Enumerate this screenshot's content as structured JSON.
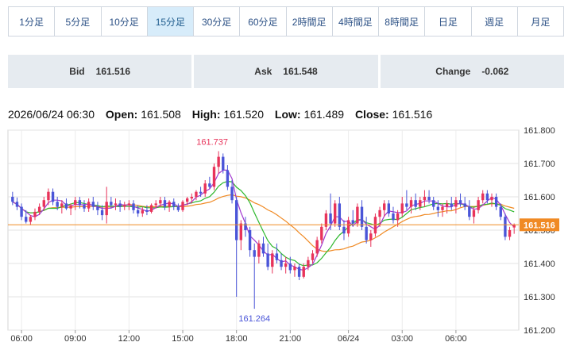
{
  "tabs": [
    {
      "label": "1分足",
      "active": false
    },
    {
      "label": "5分足",
      "active": false
    },
    {
      "label": "10分足",
      "active": false
    },
    {
      "label": "15分足",
      "active": true
    },
    {
      "label": "30分足",
      "active": false
    },
    {
      "label": "60分足",
      "active": false
    },
    {
      "label": "2時間足",
      "active": false
    },
    {
      "label": "4時間足",
      "active": false
    },
    {
      "label": "8時間足",
      "active": false
    },
    {
      "label": "日足",
      "active": false
    },
    {
      "label": "週足",
      "active": false
    },
    {
      "label": "月足",
      "active": false
    }
  ],
  "quotes": {
    "bid_label": "Bid",
    "bid": "161.516",
    "ask_label": "Ask",
    "ask": "161.548",
    "change_label": "Change",
    "change": "-0.062"
  },
  "ohlc": {
    "datetime": "2026/06/24 06:30",
    "open_label": "Open:",
    "open": "161.508",
    "high_label": "High:",
    "high": "161.520",
    "low_label": "Low:",
    "low": "161.489",
    "close_label": "Close:",
    "close": "161.516"
  },
  "colors": {
    "up": "#e8335a",
    "down": "#4a55d8",
    "ma_green": "#2db82d",
    "ma_orange": "#f08a24",
    "ma_purple": "#a23ad0",
    "current_line": "#f08a24",
    "current_badge": "#f08a24"
  },
  "chart_data": {
    "type": "candlestick",
    "ylim": [
      161.2,
      161.8
    ],
    "y_ticks": [
      "161.800",
      "161.700",
      "161.600",
      "161.500",
      "161.400",
      "161.300",
      "161.200"
    ],
    "x_tick_labels": [
      "06:00",
      "09:00",
      "12:00",
      "15:00",
      "18:00",
      "21:00",
      "06/24",
      "03:00",
      "06:00"
    ],
    "grid": true,
    "current_price": "161.516",
    "annotations": [
      {
        "text": "161.737",
        "type": "high"
      },
      {
        "text": "161.264",
        "type": "low"
      }
    ],
    "ohlc": [
      [
        161.6,
        161.615,
        161.575,
        161.585
      ],
      [
        161.585,
        161.598,
        161.56,
        161.57
      ],
      [
        161.57,
        161.58,
        161.53,
        161.54
      ],
      [
        161.54,
        161.56,
        161.52,
        161.525
      ],
      [
        161.525,
        161.545,
        161.515,
        161.54
      ],
      [
        161.54,
        161.565,
        161.53,
        161.555
      ],
      [
        161.555,
        161.58,
        161.545,
        161.57
      ],
      [
        161.57,
        161.6,
        161.56,
        161.59
      ],
      [
        161.59,
        161.625,
        161.575,
        161.615
      ],
      [
        161.615,
        161.625,
        161.575,
        161.585
      ],
      [
        161.585,
        161.6,
        161.56,
        161.57
      ],
      [
        161.57,
        161.59,
        161.55,
        161.58
      ],
      [
        161.58,
        161.595,
        161.56,
        161.565
      ],
      [
        161.565,
        161.58,
        161.545,
        161.575
      ],
      [
        161.575,
        161.6,
        161.56,
        161.59
      ],
      [
        161.59,
        161.6,
        161.565,
        161.575
      ],
      [
        161.575,
        161.59,
        161.555,
        161.565
      ],
      [
        161.565,
        161.595,
        161.555,
        161.585
      ],
      [
        161.585,
        161.6,
        161.56,
        161.57
      ],
      [
        161.57,
        161.585,
        161.545,
        161.56
      ],
      [
        161.56,
        161.575,
        161.53,
        161.545
      ],
      [
        161.545,
        161.63,
        161.52,
        161.585
      ],
      [
        161.585,
        161.6,
        161.565,
        161.575
      ],
      [
        161.575,
        161.595,
        161.56,
        161.58
      ],
      [
        161.58,
        161.59,
        161.555,
        161.57
      ],
      [
        161.57,
        161.585,
        161.56,
        161.575
      ],
      [
        161.575,
        161.59,
        161.56,
        161.58
      ],
      [
        161.58,
        161.59,
        161.55,
        161.56
      ],
      [
        161.56,
        161.575,
        161.54,
        161.55
      ],
      [
        161.55,
        161.57,
        161.54,
        161.56
      ],
      [
        161.56,
        161.575,
        161.545,
        161.555
      ],
      [
        161.555,
        161.58,
        161.55,
        161.575
      ],
      [
        161.575,
        161.59,
        161.565,
        161.58
      ],
      [
        161.58,
        161.6,
        161.57,
        161.59
      ],
      [
        161.59,
        161.6,
        161.56,
        161.57
      ],
      [
        161.57,
        161.59,
        161.555,
        161.585
      ],
      [
        161.585,
        161.595,
        161.56,
        161.57
      ],
      [
        161.57,
        161.58,
        161.555,
        161.56
      ],
      [
        161.56,
        161.59,
        161.555,
        161.585
      ],
      [
        161.585,
        161.6,
        161.575,
        161.595
      ],
      [
        161.595,
        161.61,
        161.58,
        161.6
      ],
      [
        161.6,
        161.62,
        161.59,
        161.615
      ],
      [
        161.615,
        161.63,
        161.6,
        161.61
      ],
      [
        161.61,
        161.65,
        161.6,
        161.64
      ],
      [
        161.64,
        161.66,
        161.625,
        161.63
      ],
      [
        161.63,
        161.7,
        161.62,
        161.69
      ],
      [
        161.69,
        161.737,
        161.67,
        161.72
      ],
      [
        161.72,
        161.73,
        161.67,
        161.68
      ],
      [
        161.68,
        161.695,
        161.62,
        161.63
      ],
      [
        161.63,
        161.65,
        161.58,
        161.59
      ],
      [
        161.59,
        161.6,
        161.3,
        161.47
      ],
      [
        161.47,
        161.53,
        161.44,
        161.52
      ],
      [
        161.52,
        161.54,
        161.48,
        161.5
      ],
      [
        161.5,
        161.51,
        161.42,
        161.44
      ],
      [
        161.44,
        161.46,
        161.264,
        161.42
      ],
      [
        161.42,
        161.47,
        161.4,
        161.46
      ],
      [
        161.46,
        161.48,
        161.42,
        161.43
      ],
      [
        161.43,
        161.46,
        161.38,
        161.39
      ],
      [
        161.39,
        161.44,
        161.37,
        161.43
      ],
      [
        161.43,
        161.46,
        161.4,
        161.41
      ],
      [
        161.41,
        161.43,
        161.38,
        161.39
      ],
      [
        161.39,
        161.42,
        161.37,
        161.4
      ],
      [
        161.4,
        161.42,
        161.37,
        161.38
      ],
      [
        161.38,
        161.4,
        161.36,
        161.39
      ],
      [
        161.39,
        161.4,
        161.35,
        161.36
      ],
      [
        161.36,
        161.4,
        161.355,
        161.39
      ],
      [
        161.39,
        161.42,
        161.38,
        161.41
      ],
      [
        161.41,
        161.44,
        161.4,
        161.43
      ],
      [
        161.43,
        161.48,
        161.42,
        161.47
      ],
      [
        161.47,
        161.52,
        161.46,
        161.51
      ],
      [
        161.51,
        161.56,
        161.5,
        161.55
      ],
      [
        161.55,
        161.61,
        161.5,
        161.52
      ],
      [
        161.52,
        161.59,
        161.51,
        161.58
      ],
      [
        161.58,
        161.6,
        161.5,
        161.51
      ],
      [
        161.51,
        161.53,
        161.47,
        161.49
      ],
      [
        161.49,
        161.54,
        161.48,
        161.53
      ],
      [
        161.53,
        161.56,
        161.51,
        161.52
      ],
      [
        161.52,
        161.58,
        161.51,
        161.57
      ],
      [
        161.57,
        161.59,
        161.5,
        161.51
      ],
      [
        161.51,
        161.54,
        161.46,
        161.47
      ],
      [
        161.47,
        161.5,
        161.45,
        161.49
      ],
      [
        161.49,
        161.55,
        161.48,
        161.54
      ],
      [
        161.54,
        161.57,
        161.51,
        161.56
      ],
      [
        161.56,
        161.59,
        161.54,
        161.58
      ],
      [
        161.58,
        161.59,
        161.54,
        161.55
      ],
      [
        161.55,
        161.57,
        161.52,
        161.53
      ],
      [
        161.53,
        161.56,
        161.51,
        161.55
      ],
      [
        161.55,
        161.6,
        161.54,
        161.58
      ],
      [
        161.58,
        161.62,
        161.56,
        161.57
      ],
      [
        161.57,
        161.6,
        161.55,
        161.59
      ],
      [
        161.59,
        161.61,
        161.56,
        161.57
      ],
      [
        161.57,
        161.6,
        161.56,
        161.59
      ],
      [
        161.59,
        161.62,
        161.57,
        161.6
      ],
      [
        161.6,
        161.62,
        161.58,
        161.59
      ],
      [
        161.59,
        161.6,
        161.56,
        161.57
      ],
      [
        161.57,
        161.59,
        161.54,
        161.56
      ],
      [
        161.56,
        161.58,
        161.54,
        161.57
      ],
      [
        161.57,
        161.59,
        161.55,
        161.58
      ],
      [
        161.58,
        161.6,
        161.56,
        161.57
      ],
      [
        161.57,
        161.6,
        161.55,
        161.59
      ],
      [
        161.59,
        161.61,
        161.57,
        161.58
      ],
      [
        161.58,
        161.6,
        161.56,
        161.57
      ],
      [
        161.57,
        161.59,
        161.53,
        161.54
      ],
      [
        161.54,
        161.57,
        161.52,
        161.56
      ],
      [
        161.56,
        161.6,
        161.55,
        161.59
      ],
      [
        161.59,
        161.62,
        161.58,
        161.61
      ],
      [
        161.61,
        161.62,
        161.58,
        161.59
      ],
      [
        161.59,
        161.61,
        161.57,
        161.6
      ],
      [
        161.6,
        161.61,
        161.56,
        161.57
      ],
      [
        161.57,
        161.58,
        161.53,
        161.54
      ],
      [
        161.54,
        161.55,
        161.47,
        161.48
      ],
      [
        161.48,
        161.51,
        161.47,
        161.5
      ],
      [
        161.508,
        161.52,
        161.489,
        161.516
      ]
    ]
  }
}
